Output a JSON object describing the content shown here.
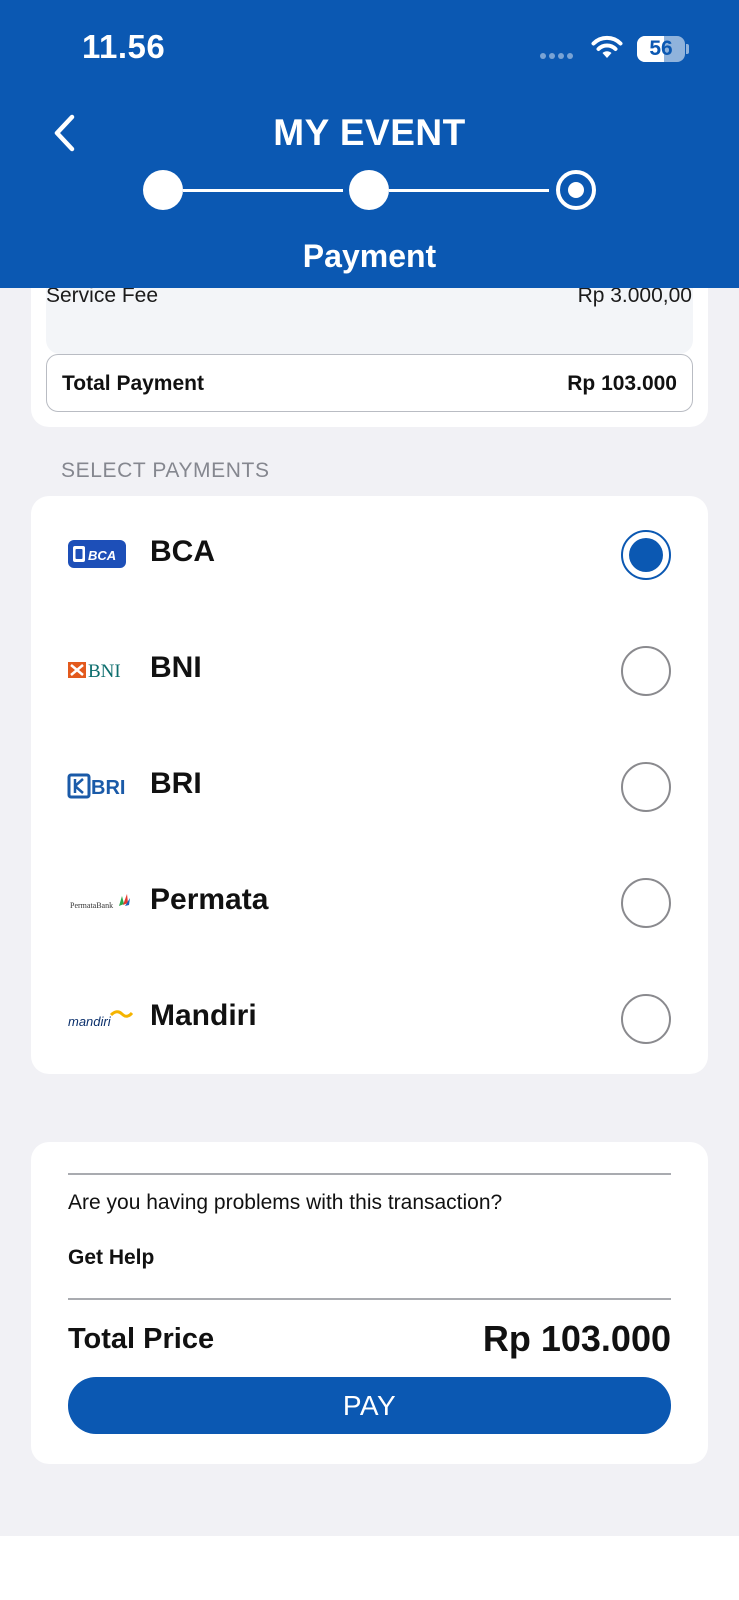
{
  "status_bar": {
    "time": "11.56",
    "battery": "56",
    "battery_level": 0.56
  },
  "header": {
    "title": "MY EVENT",
    "step_label": "Payment",
    "steps_total": 3,
    "current_step": 3
  },
  "summary": {
    "service_fee_label": "Service Fee",
    "service_fee_value": "Rp 3.000,00",
    "total_payment_label": "Total Payment",
    "total_payment_value": "Rp 103.000"
  },
  "select_payments": {
    "heading": "SELECT PAYMENTS",
    "methods": [
      {
        "name": "BCA",
        "logo_text": "BCA",
        "selected": true
      },
      {
        "name": "BNI",
        "logo_text": "BNI",
        "selected": false
      },
      {
        "name": "BRI",
        "logo_text": "BRI",
        "selected": false
      },
      {
        "name": "Permata",
        "logo_text": "PermataBank",
        "selected": false
      },
      {
        "name": "Mandiri",
        "logo_text": "mandiri",
        "selected": false
      }
    ]
  },
  "footer": {
    "help_question": "Are you having problems with this transaction?",
    "help_link": "Get Help",
    "total_price_label": "Total Price",
    "total_price_value": "Rp 103.000",
    "pay_label": "PAY"
  },
  "colors": {
    "primary": "#0b58b2",
    "background": "#f1f1f5",
    "card": "#ffffff"
  }
}
